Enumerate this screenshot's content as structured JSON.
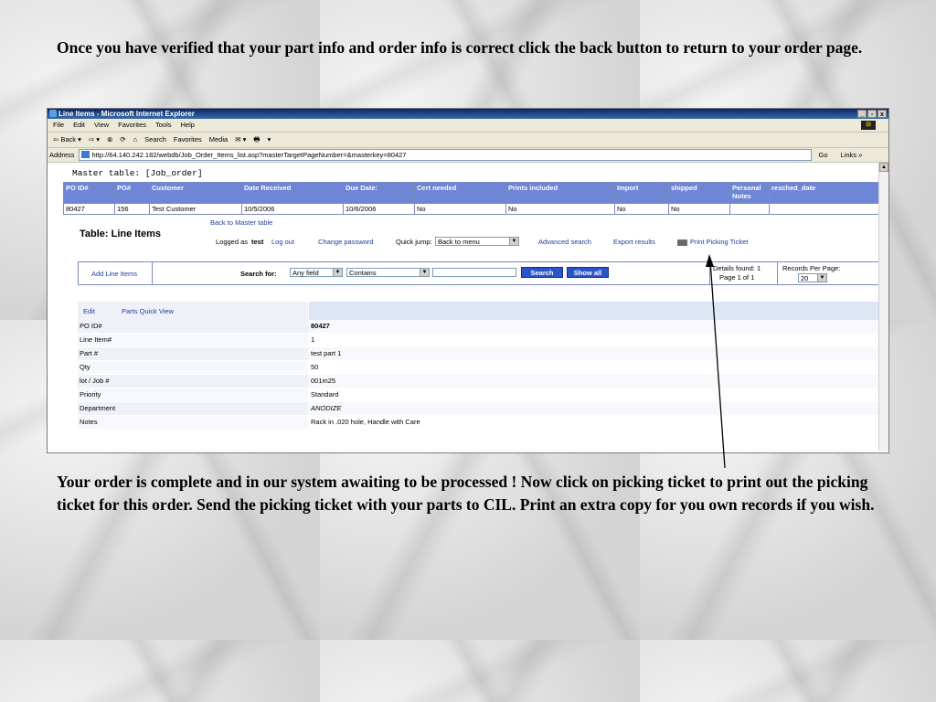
{
  "slide": {
    "top_text": "Once you have verified that your part info and order info is correct click the back button to return to your order page.",
    "bottom_text": "Your order is complete and in our system awaiting to be processed ! Now click on picking ticket to print out the picking ticket for this order. Send the picking ticket with your parts to CIL. Print an extra copy for you own records if you wish."
  },
  "browser": {
    "title": "Line Items - Microsoft Internet Explorer",
    "menu": [
      "File",
      "Edit",
      "View",
      "Favorites",
      "Tools",
      "Help"
    ],
    "toolbar": [
      "⇦ Back ▾",
      "⇨ ▾",
      "⊗",
      "⟳",
      "⌂",
      "Search",
      "Favorites",
      "Media",
      "✉ ▾",
      "🖶",
      "▾"
    ],
    "address_label": "Address",
    "url": "http://64.140.242.182/webdb/Job_Order_Items_list.asp?masterTargetPageNumber=&masterkey=80427",
    "go_label": "Go",
    "links_label": "Links »"
  },
  "master": {
    "title": "Master table: [Job_order]",
    "headers": [
      "PO ID#",
      "PO#",
      "Customer",
      "Date Received",
      "Due Date:",
      "Cert needed",
      "Prints included",
      "Import",
      "shipped",
      "Personal Notes",
      "resched_date"
    ],
    "row": [
      "80427",
      "156",
      "Test Customer",
      "10/5/2006",
      "10/6/2006",
      "No",
      "No",
      "No",
      "No",
      "",
      ""
    ]
  },
  "line_items": {
    "back_link": "Back to Master table",
    "title": "Table: Line Items",
    "logged_as_label": "Logged as",
    "user": "test",
    "logout": "Log out",
    "change_password": "Change password",
    "quick_jump_label": "Quick jump:",
    "quick_jump_value": "Back to menu",
    "advanced_search": "Advanced search",
    "export_results": "Export results",
    "print_ticket": "Print Picking Ticket"
  },
  "search": {
    "add_link": "Add Line Items",
    "search_for_label": "Search for:",
    "field_value": "Any field",
    "op_value": "Contains",
    "query_value": "",
    "search_button": "Search",
    "show_all_button": "Show all",
    "details_found": "Details found: 1",
    "page_info": "Page 1 of 1",
    "records_per_page_label": "Records Per Page:",
    "records_per_page_value": "20"
  },
  "detail": {
    "edit": "Edit",
    "quick_view": "Parts Quick View",
    "rows": [
      {
        "label": "PO ID#",
        "value": "80427"
      },
      {
        "label": "Line Item#",
        "value": "1"
      },
      {
        "label": "Part #",
        "value": "test part 1"
      },
      {
        "label": "Qty",
        "value": "50"
      },
      {
        "label": "lot / Job #",
        "value": "001m25"
      },
      {
        "label": "Priority",
        "value": "Standard"
      },
      {
        "label": "Department",
        "value": "ANODIZE"
      },
      {
        "label": "Notes",
        "value": "Rack in .020 hole, Handle with Care"
      }
    ]
  }
}
